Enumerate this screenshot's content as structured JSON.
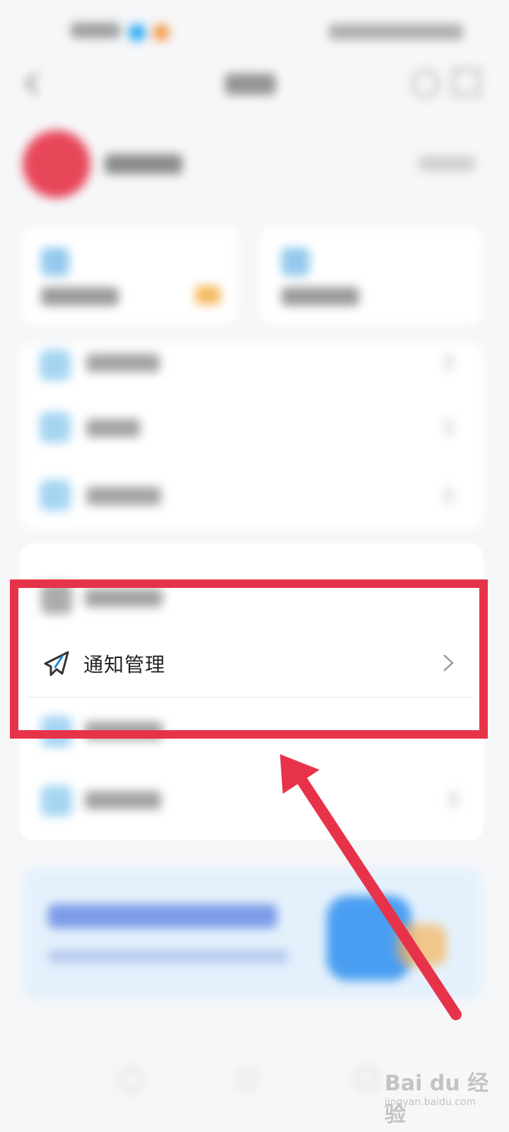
{
  "notification_row": {
    "label": "通知管理",
    "icon": "send-icon"
  },
  "colors": {
    "highlight": "#e7334a",
    "arrow": "#e7334a",
    "accent_blue": "#27a9f2"
  },
  "watermark": {
    "brand": "Bai du 经验",
    "domain": "jingyan.baidu.com"
  }
}
